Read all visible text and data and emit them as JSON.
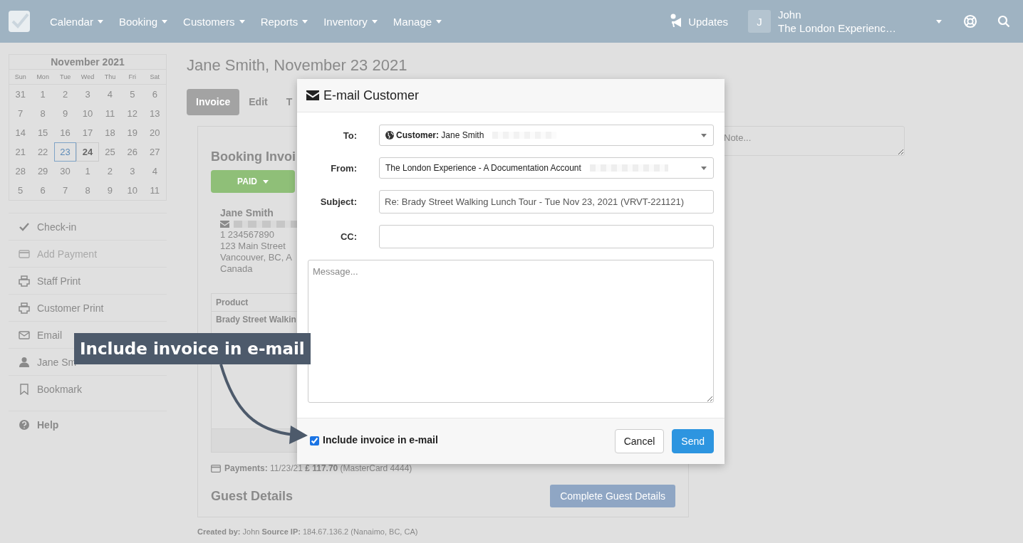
{
  "nav": {
    "menus": [
      {
        "label": "Calendar"
      },
      {
        "label": "Booking"
      },
      {
        "label": "Customers"
      },
      {
        "label": "Reports"
      },
      {
        "label": "Inventory"
      },
      {
        "label": "Manage"
      }
    ],
    "updates": {
      "label": "Updates"
    },
    "user": {
      "initial": "J",
      "name": "John",
      "account": "The London Experienc…"
    }
  },
  "calendar": {
    "title": "November 2021",
    "weekdays": [
      "Sun",
      "Mon",
      "Tue",
      "Wed",
      "Thu",
      "Fri",
      "Sat"
    ],
    "weeks": [
      [
        {
          "day": "31",
          "selected": false,
          "today": false
        },
        {
          "day": "1",
          "selected": false,
          "today": false
        },
        {
          "day": "2",
          "selected": false,
          "today": false
        },
        {
          "day": "3",
          "selected": false,
          "today": false
        },
        {
          "day": "4",
          "selected": false,
          "today": false
        },
        {
          "day": "5",
          "selected": false,
          "today": false
        },
        {
          "day": "6",
          "selected": false,
          "today": false
        }
      ],
      [
        {
          "day": "7",
          "selected": false,
          "today": false
        },
        {
          "day": "8",
          "selected": false,
          "today": false
        },
        {
          "day": "9",
          "selected": false,
          "today": false
        },
        {
          "day": "10",
          "selected": false,
          "today": false
        },
        {
          "day": "11",
          "selected": false,
          "today": false
        },
        {
          "day": "12",
          "selected": false,
          "today": false
        },
        {
          "day": "13",
          "selected": false,
          "today": false
        }
      ],
      [
        {
          "day": "14",
          "selected": false,
          "today": false
        },
        {
          "day": "15",
          "selected": false,
          "today": false
        },
        {
          "day": "16",
          "selected": false,
          "today": false
        },
        {
          "day": "17",
          "selected": false,
          "today": false
        },
        {
          "day": "18",
          "selected": false,
          "today": false
        },
        {
          "day": "19",
          "selected": false,
          "today": false
        },
        {
          "day": "20",
          "selected": false,
          "today": false
        }
      ],
      [
        {
          "day": "21",
          "selected": false,
          "today": false
        },
        {
          "day": "22",
          "selected": false,
          "today": false
        },
        {
          "day": "23",
          "selected": true,
          "today": false
        },
        {
          "day": "24",
          "selected": false,
          "today": true
        },
        {
          "day": "25",
          "selected": false,
          "today": false
        },
        {
          "day": "26",
          "selected": false,
          "today": false
        },
        {
          "day": "27",
          "selected": false,
          "today": false
        }
      ],
      [
        {
          "day": "28",
          "selected": false,
          "today": false
        },
        {
          "day": "29",
          "selected": false,
          "today": false
        },
        {
          "day": "30",
          "selected": false,
          "today": false
        },
        {
          "day": "1",
          "selected": false,
          "today": false
        },
        {
          "day": "2",
          "selected": false,
          "today": false
        },
        {
          "day": "3",
          "selected": false,
          "today": false
        },
        {
          "day": "4",
          "selected": false,
          "today": false
        }
      ],
      [
        {
          "day": "5",
          "selected": false,
          "today": false
        },
        {
          "day": "6",
          "selected": false,
          "today": false
        },
        {
          "day": "7",
          "selected": false,
          "today": false
        },
        {
          "day": "8",
          "selected": false,
          "today": false
        },
        {
          "day": "9",
          "selected": false,
          "today": false
        },
        {
          "day": "10",
          "selected": false,
          "today": false
        },
        {
          "day": "11",
          "selected": false,
          "today": false
        }
      ]
    ]
  },
  "actions": [
    {
      "kind": "checkin",
      "label": "Check-in",
      "disabled": false
    },
    {
      "kind": "payment",
      "label": "Add Payment",
      "disabled": true
    },
    {
      "kind": "print",
      "label": "Staff Print",
      "disabled": false
    },
    {
      "kind": "print",
      "label": "Customer Print",
      "disabled": false
    },
    {
      "kind": "email",
      "label": "Email",
      "disabled": false
    },
    {
      "kind": "person",
      "label": "Jane Sm",
      "disabled": false
    },
    {
      "kind": "bookmark",
      "label": "Bookmark",
      "disabled": false
    },
    {
      "kind": "help",
      "label": "Help",
      "disabled": false
    }
  ],
  "page": {
    "title": "Jane Smith, November 23 2021",
    "tabs": [
      {
        "label": "Invoice",
        "selected": true
      },
      {
        "label": "Edit",
        "selected": false
      },
      {
        "label": "T",
        "selected": false
      }
    ]
  },
  "invoice": {
    "heading": "Booking Invoi",
    "status": "PAID",
    "customer": {
      "name": "Jane Smith",
      "phone": "1 234567890",
      "address": [
        "123 Main Street",
        "Vancouver, BC, A",
        "Canada"
      ]
    },
    "table": {
      "columns": [
        "Product"
      ],
      "rows": [
        [
          "Brady Street Walkin"
        ]
      ]
    },
    "payments": "**Payments:** 11/23/21 **£ 117.70** (MasterCard 4444)",
    "guest_heading": "Guest Details",
    "guest_button": "Complete Guest Details"
  },
  "created": "**Created by:** John **Source IP:** 184.67.136.2 (Nanaimo, BC, CA)",
  "note": {
    "placeholder": "Note..."
  },
  "modal": {
    "title": "E-mail Customer",
    "fields": [
      {
        "kind": "select",
        "label": "To:",
        "value": "**Customer:** Jane Smith"
      },
      {
        "kind": "select",
        "label": "From:",
        "value": "The London Experience - A Documentation Account"
      },
      {
        "kind": "input",
        "label": "Subject:",
        "value": "Re: Brady Street Walking Lunch Tour - Tue Nov 23, 2021 (VRVT-221121)"
      },
      {
        "kind": "input",
        "label": "CC:"
      }
    ],
    "message": {
      "placeholder": "Message..."
    },
    "include_invoice": {
      "label": "Include invoice in e-mail",
      "checked": true
    },
    "buttons": [
      {
        "kind": "default",
        "label": "Cancel"
      },
      {
        "kind": "primary",
        "label": "Send"
      }
    ]
  },
  "callout": {
    "text": "Include invoice in e-mail"
  }
}
